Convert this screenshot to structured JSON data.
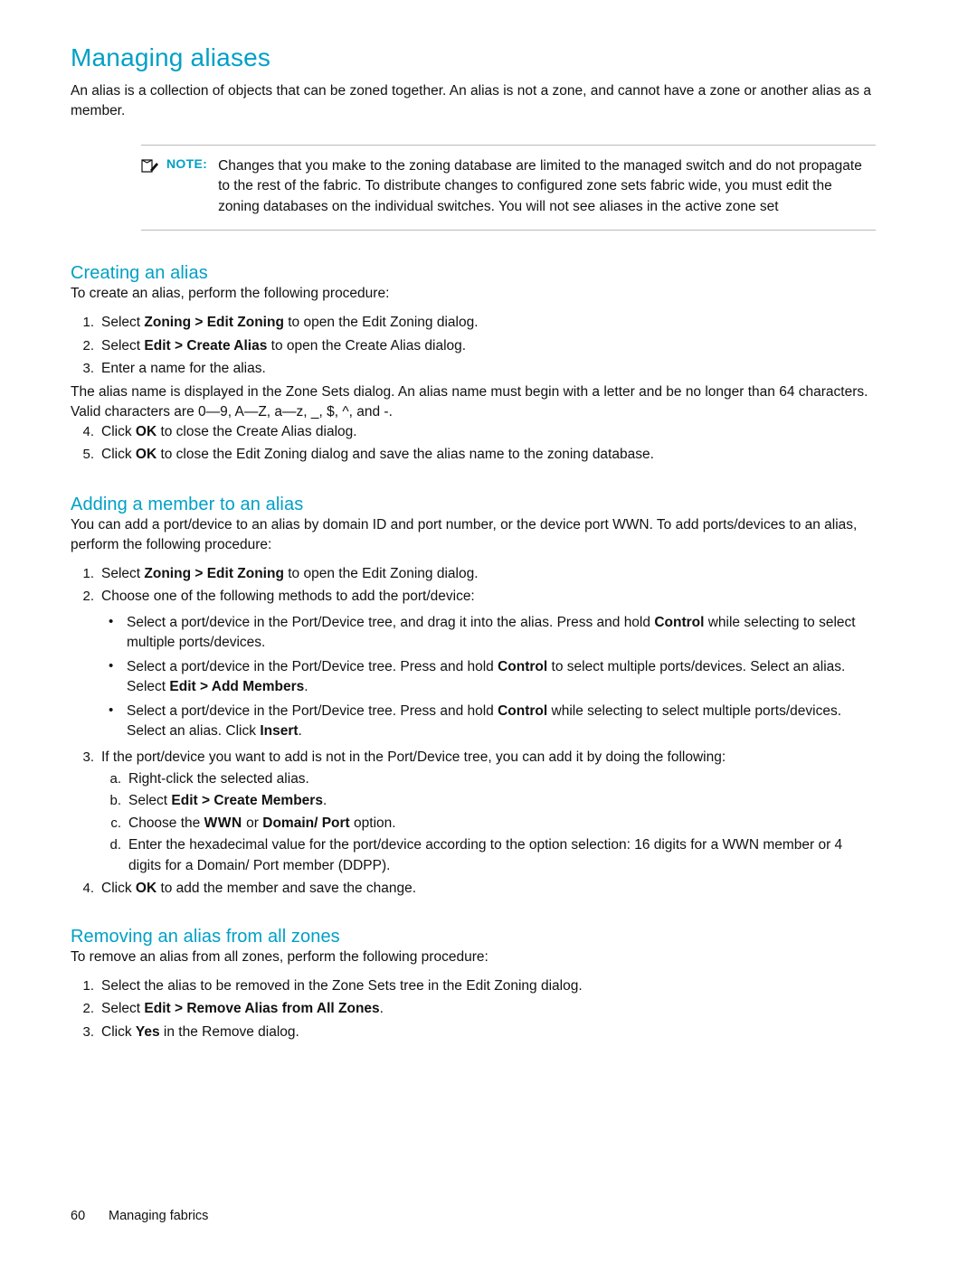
{
  "page": {
    "title": "Managing aliases",
    "footer_page_number": "60",
    "footer_chapter": "Managing fabrics",
    "accent_color": "#00a0c6"
  },
  "intro": {
    "text": "An alias is a collection of objects that can be zoned together. An alias is not a zone, and cannot have a zone or another alias as a member."
  },
  "note": {
    "label": "NOTE:",
    "icon": "note-pencil-icon",
    "text": "Changes that you make to the zoning database are limited to the managed switch and do not propagate to the rest of the fabric. To distribute changes to configured zone sets fabric wide, you must edit the zoning databases on the individual switches. You will not see aliases in the active zone set"
  },
  "creating_alias": {
    "heading": "Creating an alias",
    "lead": "To create an alias, perform the following procedure:",
    "steps": [
      {
        "num": "1.",
        "pre": "Select ",
        "bold": "Zoning > Edit Zoning",
        "post": " to open the Edit Zoning dialog."
      },
      {
        "num": "2.",
        "pre": "Select ",
        "bold": "Edit > Create Alias",
        "post": " to open the Create Alias dialog."
      },
      {
        "num": "3.",
        "pre": "Enter a name for the alias.",
        "bold": "",
        "post": ""
      }
    ],
    "step3_detail": "The alias name is displayed in the Zone Sets dialog. An alias name must begin with a letter and be no longer than 64 characters. Valid characters are 0—9, A—Z, a—z, _, $, ^, and -.",
    "steps_cont": [
      {
        "num": "4.",
        "pre": "Click ",
        "bold": "OK",
        "post": " to close the Create Alias dialog."
      },
      {
        "num": "5.",
        "pre": "Click ",
        "bold": "OK",
        "post": " to close the Edit Zoning dialog and save the alias name to the zoning database."
      }
    ]
  },
  "adding_member": {
    "heading": "Adding a member to an alias",
    "lead": "You can add a port/device to an alias by domain ID and port number, or the device port WWN. To add ports/devices to an alias, perform the following procedure:",
    "step1": {
      "num": "1.",
      "pre": "Select ",
      "bold": "Zoning > Edit Zoning",
      "post": " to open the Edit Zoning dialog."
    },
    "step2": {
      "num": "2.",
      "text": "Choose one of the following methods to add the port/device:"
    },
    "bullets": [
      {
        "pre": "Select a port/device in the Port/Device tree, and drag it into the alias. Press and hold ",
        "bold": "Control",
        "post": " while selecting to select multiple ports/devices."
      },
      {
        "pre": "Select a port/device in the Port/Device tree. Press and hold ",
        "bold": "Control",
        "post": " to select multiple ports/devices. Select an alias. Select ",
        "bold2": "Edit > Add Members",
        "post2": "."
      },
      {
        "pre": "Select a port/device in the Port/Device tree. Press and hold ",
        "bold": "Control",
        "post": " while selecting to select multiple ports/devices. Select an alias. Click ",
        "bold2": "Insert",
        "post2": "."
      }
    ],
    "step3": {
      "num": "3.",
      "text": "If the port/device you want to add is not in the Port/Device tree, you can add it by doing the following:"
    },
    "substeps": [
      {
        "num": "a.",
        "pre": "Right-click the selected alias.",
        "bold": "",
        "post": ""
      },
      {
        "num": "b.",
        "pre": "Select ",
        "bold": "Edit > Create Members",
        "post": "."
      },
      {
        "num": "c.",
        "pre": "Choose the ",
        "bold": "WWN",
        "mid": " or ",
        "bold2": "Domain/ Port",
        "post": " option."
      },
      {
        "num": "d.",
        "pre": "Enter the hexadecimal value for the port/device according to the option selection: 16 digits for a WWN member or 4 digits for a Domain/ Port member (DDPP).",
        "bold": "",
        "post": ""
      }
    ],
    "step4": {
      "num": "4.",
      "pre": "Click ",
      "bold": "OK",
      "post": " to add the member and save the change."
    }
  },
  "removing_alias": {
    "heading": "Removing an alias from all zones",
    "lead": "To remove an alias from all zones, perform the following procedure:",
    "steps": [
      {
        "num": "1.",
        "pre": "Select the alias to be removed in the Zone Sets tree in the Edit Zoning dialog.",
        "bold": "",
        "post": ""
      },
      {
        "num": "2.",
        "pre": "Select ",
        "bold": "Edit > Remove Alias from All Zones",
        "post": "."
      },
      {
        "num": "3.",
        "pre": "Click ",
        "bold": "Yes",
        "post": " in the Remove dialog."
      }
    ]
  }
}
